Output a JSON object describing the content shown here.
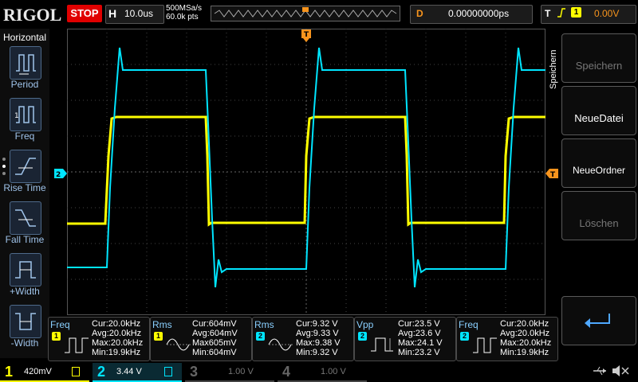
{
  "brand": "RIGOL",
  "run_state": "STOP",
  "horizontal": {
    "label": "H",
    "timebase": "10.0us",
    "sample_rate": "500MSa/s",
    "points": "60.0k pts"
  },
  "delay": {
    "label": "D",
    "value": "0.00000000ps"
  },
  "trigger": {
    "label": "T",
    "source": "1",
    "level": "0.00V"
  },
  "left_menu": {
    "title": "Horizontal",
    "items": [
      {
        "label": "Period"
      },
      {
        "label": "Freq"
      },
      {
        "label": "Rise Time"
      },
      {
        "label": "Fall Time"
      },
      {
        "label": "+Width"
      },
      {
        "label": "-Width"
      }
    ]
  },
  "right_menu": {
    "title": "Speichern",
    "items": [
      {
        "label": "Speichern",
        "enabled": false
      },
      {
        "label": "NeueDatei",
        "enabled": true
      },
      {
        "label": "NeueOrdner",
        "enabled": true
      },
      {
        "label": "Löschen",
        "enabled": false
      },
      {
        "label": "",
        "enabled": true,
        "icon": "return-icon"
      }
    ]
  },
  "markers": {
    "ch2_ground": "2",
    "trigger_level": "T",
    "trigger_pos": "T"
  },
  "measurements": [
    {
      "name": "Freq",
      "source": "1",
      "cur": "Cur:20.0kHz",
      "avg": "Avg:20.0kHz",
      "max": "Max:20.0kHz",
      "min": "Min:19.9kHz"
    },
    {
      "name": "Rms",
      "source": "1",
      "cur": "Cur:604mV",
      "avg": "Avg:604mV",
      "max": "Max605mV",
      "min": "Min:604mV"
    },
    {
      "name": "Rms",
      "source": "2",
      "cur": "Cur:9.32 V",
      "avg": "Avg:9.33 V",
      "max": "Max:9.38 V",
      "min": "Min:9.32 V"
    },
    {
      "name": "Vpp",
      "source": "2",
      "cur": "Cur:23.5 V",
      "avg": "Avg:23.6 V",
      "max": "Max:24.1 V",
      "min": "Min:23.2 V"
    },
    {
      "name": "Freq",
      "source": "2",
      "cur": "Cur:20.0kHz",
      "avg": "Avg:20.0kHz",
      "max": "Max:20.0kHz",
      "min": "Min:19.9kHz"
    }
  ],
  "channels": [
    {
      "num": "1",
      "scale": "420mV",
      "color": "#ffff00",
      "active": true
    },
    {
      "num": "2",
      "scale": "3.44 V",
      "color": "#00e5ff",
      "active": true
    },
    {
      "num": "3",
      "scale": "1.00 V",
      "color": "#777777",
      "active": false
    },
    {
      "num": "4",
      "scale": "1.00 V",
      "color": "#777777",
      "active": false
    }
  ],
  "colors": {
    "ch1": "#ffff00",
    "ch2": "#00e5ff",
    "trigger": "#f7941d",
    "stop": "#e00000"
  }
}
